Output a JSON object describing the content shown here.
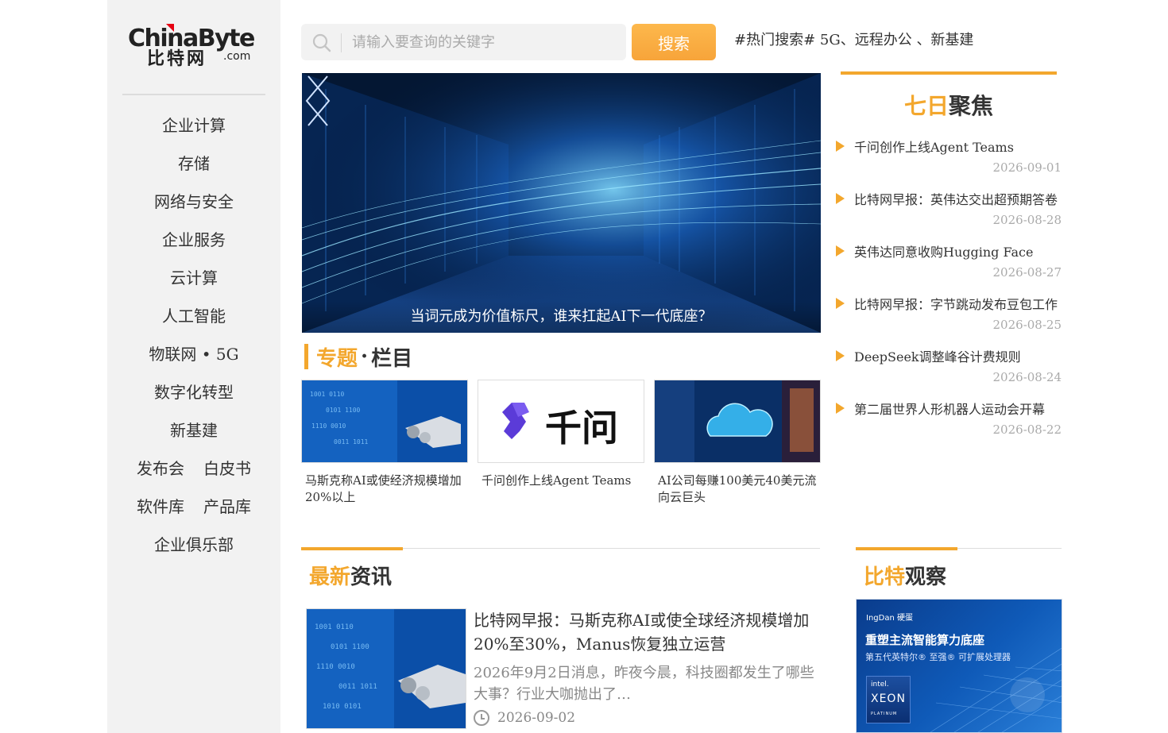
{
  "logo": {
    "main": "ChinaByte",
    "cn": "比特网",
    "com": ".com"
  },
  "sidebar": {
    "items": [
      {
        "label": "企业计算"
      },
      {
        "label": "存储"
      },
      {
        "label": "网络与安全"
      },
      {
        "label": "企业服务"
      },
      {
        "label": "云计算"
      },
      {
        "label": "人工智能"
      },
      {
        "label": "物联网 • 5G"
      },
      {
        "label": "数字化转型"
      },
      {
        "label": "新基建"
      }
    ],
    "pairs": [
      [
        "发布会",
        "白皮书"
      ],
      [
        "软件库",
        "产品库"
      ]
    ],
    "last": "企业俱乐部"
  },
  "search": {
    "placeholder": "请输入要查询的关键字",
    "value": "",
    "button": "搜索",
    "hot": "#热门搜索# 5G、远程办公 、新基建"
  },
  "banner": {
    "caption": "当词元成为价值标尺，谁来扛起AI下一代底座？"
  },
  "topics": {
    "highlight": "专题",
    "dot": "·",
    "rest": "栏目",
    "cards": [
      {
        "title": "马斯克称AI或使经济规模增加20%以上"
      },
      {
        "title": "千问创作上线Agent Teams",
        "logo_text": "千问"
      },
      {
        "title": "AI公司每赚100美元40美元流向云巨头"
      }
    ]
  },
  "seven_day": {
    "highlight": "七日",
    "rest": "聚焦",
    "items": [
      {
        "title": "千问创作上线Agent Teams",
        "date": "2026-09-01"
      },
      {
        "title": "比特网早报：英伟达交出超预期答卷",
        "date": "2026-08-28"
      },
      {
        "title": "英伟达同意收购Hugging Face",
        "date": "2026-08-27"
      },
      {
        "title": "比特网早报：字节跳动发布豆包工作",
        "date": "2026-08-25"
      },
      {
        "title": "DeepSeek调整峰谷计费规则",
        "date": "2026-08-24"
      },
      {
        "title": "第二届世界人形机器人运动会开幕",
        "date": "2026-08-22"
      }
    ]
  },
  "latest": {
    "highlight": "最新",
    "rest": "资讯",
    "news": {
      "title": "比特网早报：马斯克称AI或使全球经济规模增加20%至30%，Manus恢复独立运营",
      "desc": "2026年9月2日消息，昨夜今晨，科技圈都发生了哪些大事？行业大咖抛出了…",
      "date": "2026-09-02"
    }
  },
  "observe": {
    "highlight": "比特",
    "rest": "观察",
    "ad": {
      "brand": "IngDan 硬蛋",
      "headline": "重塑主流智能算力底座",
      "sub": "第五代英特尔® 至强® 可扩展处理器",
      "chip_brand": "intel.",
      "chip_name": "XEON",
      "chip_tier": "PLATINUM"
    }
  },
  "colors": {
    "accent": "#f3a72d",
    "sidebar_bg": "#f2f2f2",
    "date": "#aaaaaa"
  }
}
